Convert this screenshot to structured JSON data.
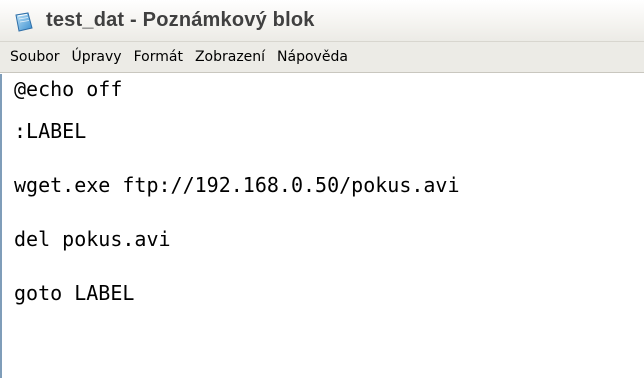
{
  "window": {
    "title": "test_dat - Poznámkový blok",
    "app_icon": "notepad-icon"
  },
  "menu": {
    "items": [
      "Soubor",
      "Úpravy",
      "Formát",
      "Zobrazení",
      "Nápověda"
    ]
  },
  "editor": {
    "lines": [
      "@echo off",
      ":LABEL",
      "wget.exe ftp://192.168.0.50/pokus.avi",
      "del pokus.avi",
      "goto LABEL"
    ]
  },
  "colors": {
    "titlebar": "#f7f6f3",
    "menubar": "#ecebe6",
    "title_text": "#404040",
    "editor_bg": "#ffffff"
  }
}
